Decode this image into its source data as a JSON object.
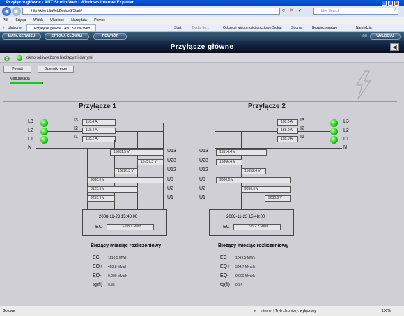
{
  "window": {
    "title": "Przyłącze główne - ANT Studio Web - Windows Internet Explorer"
  },
  "browser": {
    "url": "http://klient.lt/WebDeviceS/Start#",
    "search_placeholder": "Live Search",
    "menu": [
      "Plik",
      "Edycja",
      "Widok",
      "Ulubione",
      "Narzędzia",
      "Pomoc"
    ],
    "favorites_label": "Ulubione",
    "tab_label": "Przyłącze główne - ANT Studio Web",
    "toolbar": [
      "Start",
      "Dodaj do...",
      "Odczytaj wiadomości pocztowe",
      "Drukuj",
      "Strona",
      "Bezpieczeństwo",
      "Narzędzia"
    ],
    "status_left": "Gotowe",
    "status_zone": "Internet | Tryb chroniony: wyłączony",
    "zoom": "100%"
  },
  "app": {
    "nav": {
      "site_map": "MAPA SERWISU",
      "home": "STRONA GŁÓWNA",
      "back": "POWRÓT",
      "user": "drill",
      "logout": "WYLOGUJ"
    },
    "title": "Przyłącze główne",
    "status_text": "okno odświeżone bieżącymi danymi",
    "buttons": {
      "back": "Powrót",
      "history": "Dziennik reczy"
    },
    "comm_label": "Komunikacja"
  },
  "panels": [
    {
      "title": "Przyłącze 1",
      "phases": [
        "L3",
        "L2",
        "L1",
        "N"
      ],
      "currents": [
        {
          "label": "I3",
          "value": "118.4 A"
        },
        {
          "label": "I2",
          "value": "118.4 A"
        },
        {
          "label": "I1",
          "value": "118.2 A"
        }
      ],
      "voltages": [
        {
          "label": "U13",
          "value": "15081.5 V"
        },
        {
          "label": "U23",
          "value": "15757.3 V"
        },
        {
          "label": "U12",
          "value": "15826.3 V"
        },
        {
          "label": "U3",
          "value": "9080.0 V"
        },
        {
          "label": "U2",
          "value": "8125.3 V"
        },
        {
          "label": "U1",
          "value": "9255.9 V"
        }
      ],
      "meter": {
        "datetime": "2008-11-23 15:48:00",
        "ec_label": "EC",
        "ec_value": "3768.1 MWh"
      },
      "summary_title": "Bieżący miesiąc rozliczeniowy",
      "summary": [
        {
          "label": "EC",
          "value": "1110.5 MWh"
        },
        {
          "label": "EQ+",
          "value": "403.8 Mvarh"
        },
        {
          "label": "EQ-",
          "value": "0.000 Mvarh"
        },
        {
          "label": "tg(fi)",
          "value": "0.36"
        }
      ]
    },
    {
      "title": "Przyłącze 2",
      "phases": [
        "L3",
        "L2",
        "L1",
        "N"
      ],
      "currents": [
        {
          "label": "I3",
          "value": "138.0 A"
        },
        {
          "label": "I2",
          "value": "138.0 A"
        },
        {
          "label": "I1",
          "value": "138.0 A"
        }
      ],
      "voltages": [
        {
          "label": "U13",
          "value": "15514.4 V"
        },
        {
          "label": "U23",
          "value": "15866.4 V"
        },
        {
          "label": "U12",
          "value": "15652.4 V"
        },
        {
          "label": "U3",
          "value": "9000.0 V"
        },
        {
          "label": "U2",
          "value": "9090.0 V"
        },
        {
          "label": "U1",
          "value": "9030.0 V"
        }
      ],
      "meter": {
        "datetime": "2008-11-23 15:48:00",
        "ec_label": "EC",
        "ec_value": "5292.2 MWh"
      },
      "summary_title": "Bieżący miesiąc rozliczeniowy",
      "summary": [
        {
          "label": "EC",
          "value": "1069.5 MWh"
        },
        {
          "label": "EQ+",
          "value": "364.7 Mvarh"
        },
        {
          "label": "EQ-",
          "value": "0.000 Mvarh"
        },
        {
          "label": "tg(fi)",
          "value": "0.34"
        }
      ]
    }
  ],
  "colors": {
    "led": "#22c81e",
    "header_bg": "#0b1a33",
    "panel_bg": "#cfcfd5"
  }
}
